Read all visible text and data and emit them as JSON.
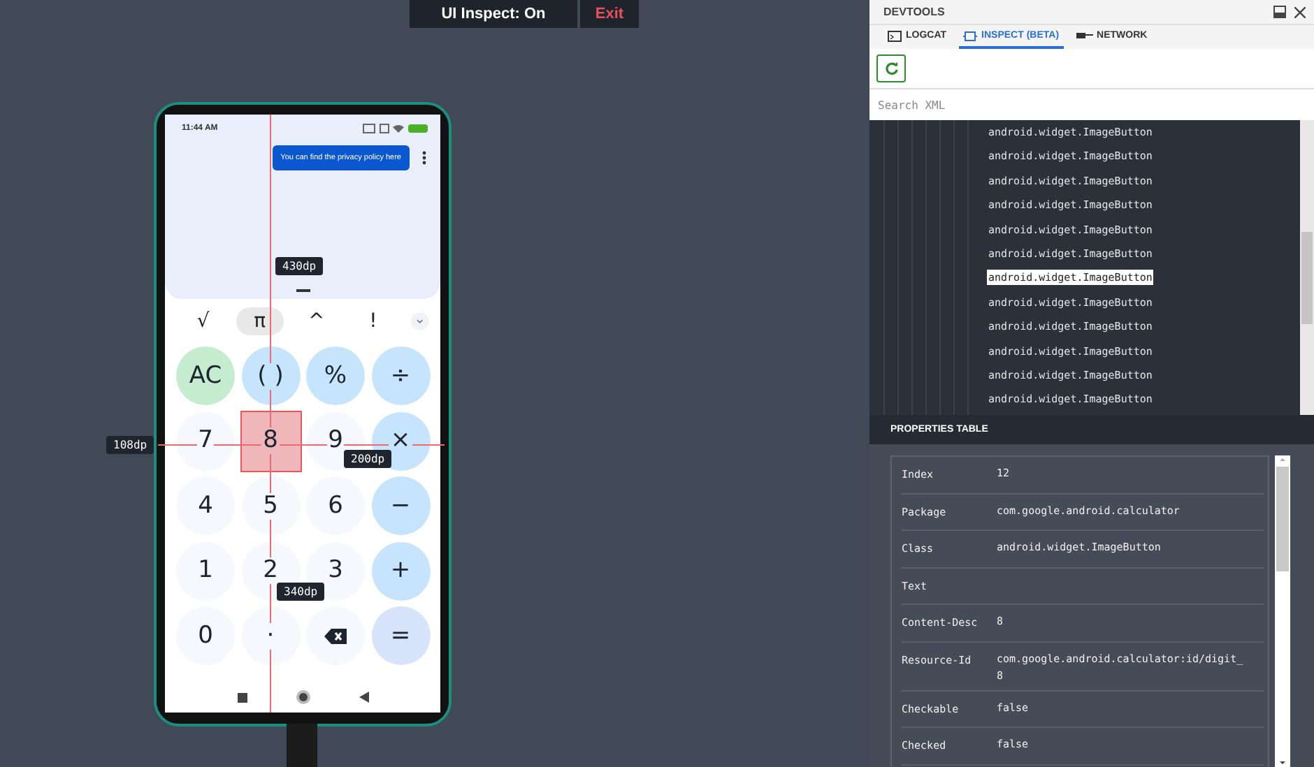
{
  "inspect_bar": {
    "status": "UI Inspect: On",
    "exit": "Exit"
  },
  "phone": {
    "time": "11:44 AM",
    "tooltip": "You can find the privacy policy here",
    "scientific_keys": [
      {
        "label": "√",
        "selected": false
      },
      {
        "label": "π",
        "selected": true
      },
      {
        "label": "^",
        "selected": false
      },
      {
        "label": "!",
        "selected": false
      }
    ],
    "keys": [
      {
        "label": "AC",
        "kind": "clear",
        "inspected": false
      },
      {
        "label": "( )",
        "kind": "op",
        "inspected": false
      },
      {
        "label": "%",
        "kind": "op",
        "inspected": false
      },
      {
        "label": "÷",
        "kind": "op",
        "inspected": false
      },
      {
        "label": "7",
        "kind": "digit",
        "inspected": false
      },
      {
        "label": "8",
        "kind": "digit",
        "inspected": true
      },
      {
        "label": "9",
        "kind": "digit",
        "inspected": false
      },
      {
        "label": "×",
        "kind": "op",
        "inspected": false
      },
      {
        "label": "4",
        "kind": "digit",
        "inspected": false
      },
      {
        "label": "5",
        "kind": "digit",
        "inspected": false
      },
      {
        "label": "6",
        "kind": "digit",
        "inspected": false
      },
      {
        "label": "−",
        "kind": "op",
        "inspected": false
      },
      {
        "label": "1",
        "kind": "digit",
        "inspected": false
      },
      {
        "label": "2",
        "kind": "digit",
        "inspected": false
      },
      {
        "label": "3",
        "kind": "digit",
        "inspected": false
      },
      {
        "label": "+",
        "kind": "op",
        "inspected": false
      },
      {
        "label": "0",
        "kind": "digit",
        "inspected": false
      },
      {
        "label": "·",
        "kind": "digit",
        "inspected": false
      },
      {
        "kind": "backspace",
        "inspected": false
      },
      {
        "label": "=",
        "kind": "equals",
        "inspected": false
      }
    ]
  },
  "measurements": {
    "height": "430dp",
    "left": "108dp",
    "right": "200dp",
    "bottom": "340dp"
  },
  "devtools": {
    "title": "DEVTOOLS",
    "tabs": [
      {
        "label": "LOGCAT",
        "selected": false
      },
      {
        "label": "INSPECT (BETA)",
        "selected": true
      },
      {
        "label": "NETWORK",
        "selected": false
      }
    ],
    "search": {
      "placeholder": "Search XML"
    },
    "tree": [
      {
        "label": "android.widget.ImageButton",
        "selected": false
      },
      {
        "label": "android.widget.ImageButton",
        "selected": false
      },
      {
        "label": "android.widget.ImageButton",
        "selected": false
      },
      {
        "label": "android.widget.ImageButton",
        "selected": false
      },
      {
        "label": "android.widget.ImageButton",
        "selected": false
      },
      {
        "label": "android.widget.ImageButton",
        "selected": false
      },
      {
        "label": "android.widget.ImageButton",
        "selected": true
      },
      {
        "label": "android.widget.ImageButton",
        "selected": false
      },
      {
        "label": "android.widget.ImageButton",
        "selected": false
      },
      {
        "label": "android.widget.ImageButton",
        "selected": false
      },
      {
        "label": "android.widget.ImageButton",
        "selected": false
      },
      {
        "label": "android.widget.ImageButton",
        "selected": false
      }
    ],
    "properties_title": "PROPERTIES TABLE",
    "properties": [
      {
        "name": "Index",
        "value": "12"
      },
      {
        "name": "Package",
        "value": "com.google.android.calculator"
      },
      {
        "name": "Class",
        "value": "android.widget.ImageButton"
      },
      {
        "name": "Text"
      },
      {
        "name": "Content-Desc",
        "value": "8"
      },
      {
        "name": "Resource-Id",
        "value": "com.google.android.calculator:id/digit_8"
      },
      {
        "name": "Checkable",
        "value": "false"
      },
      {
        "name": "Checked",
        "value": "false"
      }
    ]
  }
}
